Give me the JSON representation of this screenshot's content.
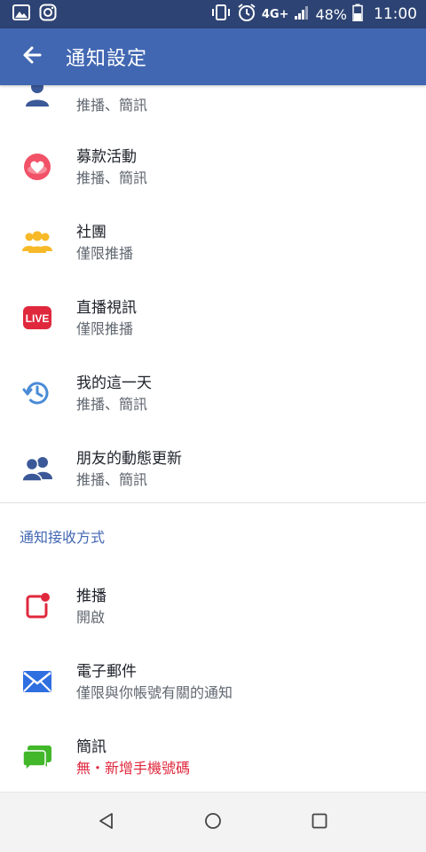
{
  "status_bar": {
    "network": "4G+",
    "battery": "48%",
    "time": "11:00",
    "icons": [
      "gallery-icon",
      "instagram-icon",
      "vibrate-icon",
      "alarm-icon",
      "signal-icon",
      "battery-icon"
    ]
  },
  "app_bar": {
    "title": "通知設定",
    "back_icon": "arrow-left-icon",
    "background": "#4267b2"
  },
  "notification_types": [
    {
      "title": "",
      "subtitle": "推播、簡訊",
      "icon": "profile-icon"
    },
    {
      "title": "募款活動",
      "subtitle": "推播、簡訊",
      "icon": "fundraiser-heart-icon"
    },
    {
      "title": "社團",
      "subtitle": "僅限推播",
      "icon": "groups-icon"
    },
    {
      "title": "直播視訊",
      "subtitle": "僅限推播",
      "icon": "live-video-icon",
      "badge": "LIVE"
    },
    {
      "title": "我的這一天",
      "subtitle": "推播、簡訊",
      "icon": "memories-clock-icon"
    },
    {
      "title": "朋友的動態更新",
      "subtitle": "推播、簡訊",
      "icon": "friends-icon"
    }
  ],
  "delivery_section": {
    "header": "通知接收方式",
    "items": [
      {
        "title": "推播",
        "subtitle": "開啟",
        "icon": "push-notification-icon"
      },
      {
        "title": "電子郵件",
        "subtitle": "僅限與你帳號有關的通知",
        "icon": "email-icon"
      },
      {
        "title": "簡訊",
        "subtitle": "無・新增手機號碼",
        "icon": "sms-chat-icon",
        "subtitle_color": "#e0283d"
      }
    ]
  },
  "nav_bar": {
    "buttons": [
      "back-triangle-icon",
      "home-circle-icon",
      "recents-square-icon"
    ]
  }
}
